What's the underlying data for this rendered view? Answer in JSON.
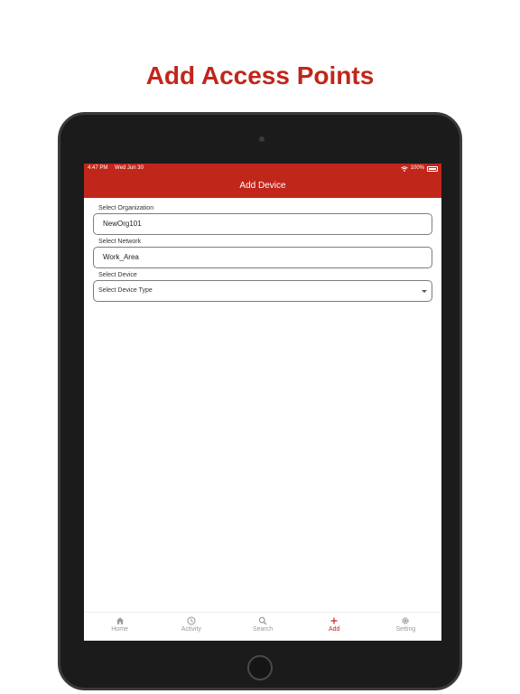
{
  "headline": "Add Access Points",
  "status_bar": {
    "time": "4:47 PM",
    "date": "Wed Jun 30",
    "battery": "100%"
  },
  "nav": {
    "title": "Add Device"
  },
  "form": {
    "organization": {
      "label": "Select Organization",
      "value": "NewOrg101"
    },
    "network": {
      "label": "Select Network",
      "value": "Work_Area"
    },
    "device": {
      "label": "Select Device",
      "placeholder": "Select Device Type"
    }
  },
  "tabs": [
    {
      "label": "Home",
      "icon": "home-icon"
    },
    {
      "label": "Activity",
      "icon": "clock-icon"
    },
    {
      "label": "Search",
      "icon": "search-icon"
    },
    {
      "label": "Add",
      "icon": "plus-icon",
      "active": true
    },
    {
      "label": "Setting",
      "icon": "gear-icon"
    }
  ],
  "colors": {
    "accent": "#c1261a",
    "inactive_tab": "#9a9a9a"
  }
}
